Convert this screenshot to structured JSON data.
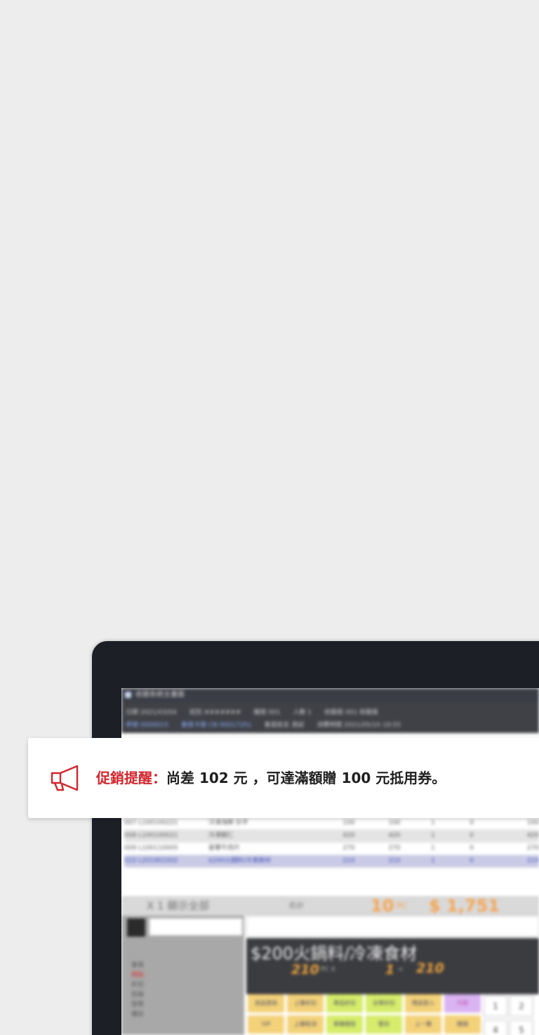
{
  "pos": {
    "window_title": "收銀系統主畫面",
    "info": {
      "row1": [
        "日期 2021/03/04",
        "班別 #######",
        "機號 001",
        "人數 1",
        "收銀員 001 收銀員"
      ],
      "row2": [
        "序號 0000015",
        "會員卡號 CN 00017251",
        "會員姓名 測試",
        "消費時間 2021/05/10 19:55"
      ]
    },
    "rows": [
      {
        "code": "007 L100100221",
        "name": "冷凍海鮮 炒手",
        "price": "100",
        "price2": "100",
        "qty": "1",
        "disc": "0",
        "total": "100",
        "style": "normal"
      },
      {
        "code": "008 L100100021",
        "name": "冷凍蝦仁",
        "price": "420",
        "price2": "420",
        "qty": "1",
        "disc": "0",
        "total": "420",
        "style": "alt"
      },
      {
        "code": "009 L100110005",
        "name": "豪華牛肉片",
        "price": "270",
        "price2": "270",
        "qty": "1",
        "disc": "0",
        "total": "270",
        "style": "normal"
      },
      {
        "code": "010 L201901002",
        "name": "$200火鍋料/冷凍食材",
        "price": "210",
        "price2": "210",
        "qty": "1",
        "disc": "0",
        "total": "210",
        "style": "sel"
      }
    ],
    "summary": {
      "label": "X 1 顯示全部",
      "count_label": "合計",
      "qty": "10",
      "qty_unit": "PC",
      "amount": "$ 1,751"
    },
    "left_list": [
      "會員",
      "積點",
      "折扣",
      "促銷",
      "發票",
      "備註"
    ],
    "product": {
      "name": "$200火鍋料/冷凍食材",
      "price": "210",
      "unit": "PC X",
      "qty": "1",
      "x": "=",
      "subtotal": "210"
    },
    "func_keys": [
      {
        "label": "商品查詢",
        "color": "#f3d27a"
      },
      {
        "label": "上筆折扣",
        "color": "#f3d27a"
      },
      {
        "label": "單品折扣",
        "color": "#d6ec6a"
      },
      {
        "label": "全單折扣",
        "color": "#d6ec6a"
      },
      {
        "label": "贈品登入",
        "color": "#f3d27a"
      },
      {
        "label": "作廢",
        "color": "#d9b3f2"
      },
      {
        "label": "VIP",
        "color": "#f3d27a"
      },
      {
        "label": "上筆取消",
        "color": "#f3d27a"
      },
      {
        "label": "單筆刪除",
        "color": "#d6ec6a"
      },
      {
        "label": "暫存",
        "color": "#d6ec6a"
      },
      {
        "label": "上一筆",
        "color": "#f3d27a"
      },
      {
        "label": "開錢",
        "color": "#f3d27a"
      }
    ],
    "num_keys": [
      "1",
      "2",
      "4",
      "5"
    ]
  },
  "toast": {
    "icon": "megaphone-icon",
    "label": "促銷提醒：",
    "message": "尚差  102 元 ，可達滿額贈 100 元抵用券。",
    "accent": "#d3252c"
  }
}
